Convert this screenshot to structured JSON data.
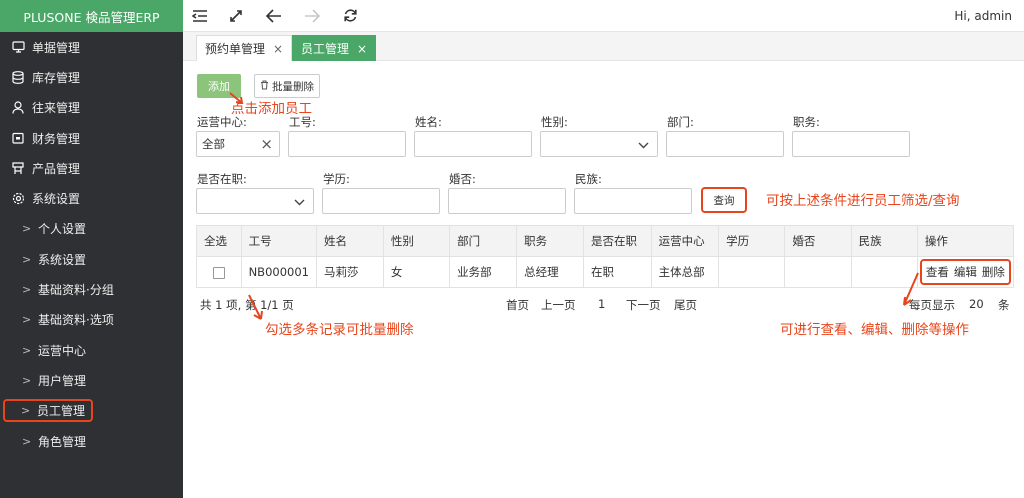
{
  "brand": "PLUSONE 検品管理ERP",
  "sidebar": {
    "items": [
      {
        "label": "单据管理",
        "icon": "monitor-icon"
      },
      {
        "label": "库存管理",
        "icon": "database-icon"
      },
      {
        "label": "往来管理",
        "icon": "user-icon"
      },
      {
        "label": "财务管理",
        "icon": "wallet-icon"
      },
      {
        "label": "产品管理",
        "icon": "product-icon"
      },
      {
        "label": "系统设置",
        "icon": "gear-icon"
      }
    ],
    "subitems": [
      {
        "label": "个人设置"
      },
      {
        "label": "系统设置"
      },
      {
        "label": "基础资料·分组"
      },
      {
        "label": "基础资料·选项"
      },
      {
        "label": "运营中心"
      },
      {
        "label": "用户管理"
      },
      {
        "label": "员工管理"
      },
      {
        "label": "角色管理"
      }
    ]
  },
  "topbar": {
    "user": "Hi, admin"
  },
  "tabs": [
    {
      "label": "预约单管理",
      "close": "×"
    },
    {
      "label": "员工管理",
      "close": "×"
    }
  ],
  "actions": {
    "add": "添加",
    "batch_delete": "批量删除",
    "query": "查询"
  },
  "annotations": {
    "add": "点击添加员工",
    "query": "可按上述条件进行员工筛选/查询",
    "batch": "勾选多条记录可批量删除",
    "ops": "可进行查看、编辑、删除等操作"
  },
  "filters": {
    "ops_center": {
      "label": "运营中心:",
      "value": "全部",
      "clear": "×"
    },
    "emp_no": {
      "label": "工号:"
    },
    "name": {
      "label": "姓名:"
    },
    "gender": {
      "label": "性别:"
    },
    "dept": {
      "label": "部门:"
    },
    "position": {
      "label": "职务:"
    },
    "employed": {
      "label": "是否在职:"
    },
    "education": {
      "label": "学历:"
    },
    "married": {
      "label": "婚否:"
    },
    "ethnicity": {
      "label": "民族:"
    }
  },
  "table": {
    "headers": [
      "全选",
      "工号",
      "姓名",
      "性别",
      "部门",
      "职务",
      "是否在职",
      "运营中心",
      "学历",
      "婚否",
      "民族",
      "操作"
    ],
    "rows": [
      {
        "emp_no": "NB000001",
        "name": "马莉莎",
        "gender": "女",
        "dept": "业务部",
        "position": "总经理",
        "employed": "在职",
        "ops_center": "主体总部",
        "education": "",
        "married": "",
        "ethnicity": "",
        "view": "查看",
        "edit": "编辑",
        "delete": "删除"
      }
    ]
  },
  "pager": {
    "summary": "共 1 项, 第 1/1 页",
    "first": "首页",
    "prev": "上一页",
    "page": "1",
    "next": "下一页",
    "last": "尾页",
    "per_page_label": "每页显示",
    "per_page": "20",
    "unit": "条"
  },
  "colors": {
    "brand_green": "#4aa768",
    "add_green": "#8cc47c",
    "annotation_red": "#e8451c",
    "sidebar": "#2f3033"
  }
}
